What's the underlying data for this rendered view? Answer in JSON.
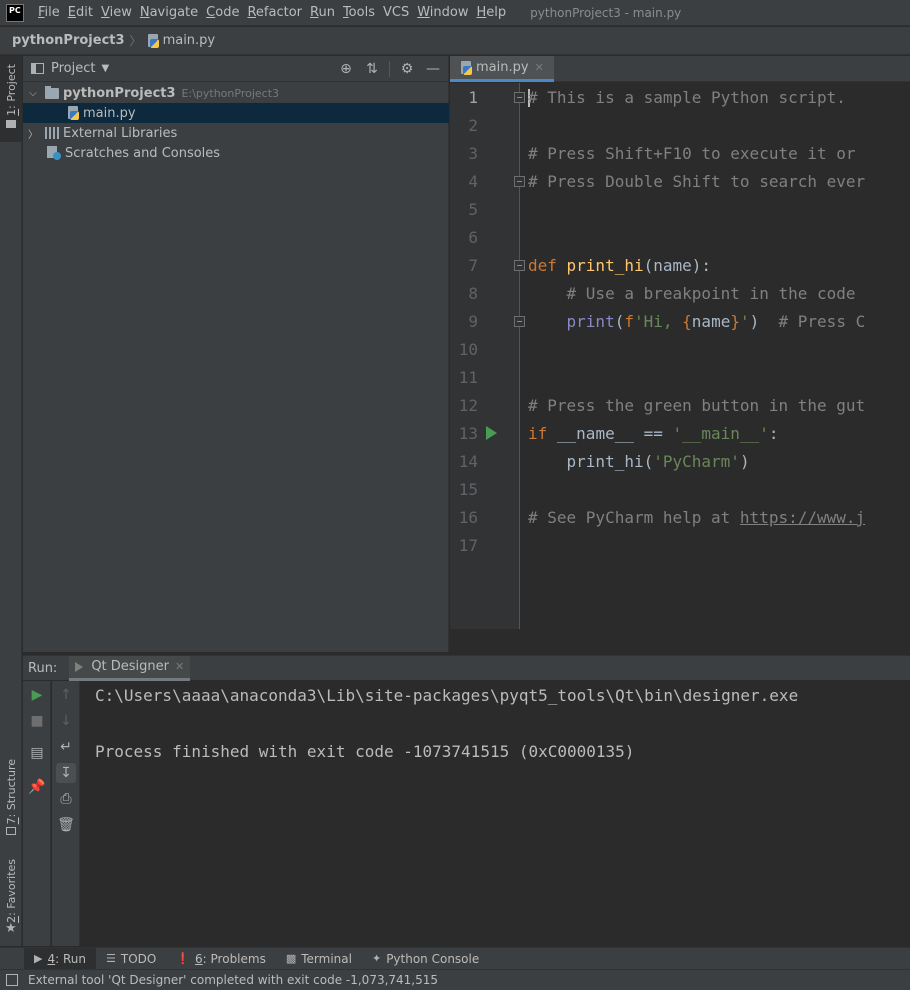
{
  "app": {
    "logo": "PC",
    "window_title": "pythonProject3 - main.py"
  },
  "menu": [
    {
      "underline": "F",
      "rest": "ile"
    },
    {
      "underline": "E",
      "rest": "dit"
    },
    {
      "underline": "V",
      "rest": "iew"
    },
    {
      "underline": "N",
      "rest": "avigate"
    },
    {
      "underline": "C",
      "rest": "ode"
    },
    {
      "underline": "R",
      "rest": "efactor"
    },
    {
      "underline": "R",
      "rest": "un"
    },
    {
      "underline": "T",
      "rest": "ools"
    },
    {
      "underline": "",
      "rest": "VCS"
    },
    {
      "underline": "W",
      "rest": "indow"
    },
    {
      "underline": "H",
      "rest": "elp"
    }
  ],
  "breadcrumb": {
    "project": "pythonProject3",
    "file": "main.py"
  },
  "left_strip": {
    "project_tab_num": "1",
    "project_tab_label": ": Project",
    "structure_tab_num": "7",
    "structure_tab_label": ": Structure",
    "favorites_tab_num": "2",
    "favorites_tab_label": ": Favorites"
  },
  "project_panel": {
    "title": "Project",
    "tree": {
      "root_name": "pythonProject3",
      "root_path": "E:\\pythonProject3",
      "file": "main.py",
      "external_libraries": "External Libraries",
      "scratches": "Scratches and Consoles"
    }
  },
  "editor": {
    "tab_label": "main.py",
    "line_numbers": [
      "1",
      "2",
      "3",
      "4",
      "5",
      "6",
      "7",
      "8",
      "9",
      "10",
      "11",
      "12",
      "13",
      "14",
      "15",
      "16",
      "17"
    ],
    "code": {
      "l1": "# This is a sample Python script.",
      "l3": "# Press Shift+F10 to execute it or",
      "l4": "# Press Double Shift to search ever",
      "l7_kw": "def ",
      "l7_fn": "print_hi",
      "l7_rest": "(name):",
      "l8": "    # Use a breakpoint in the code",
      "l9_indent": "    ",
      "l9_bi": "print",
      "l9_paren": "(",
      "l9_fp": "f",
      "l9_str1": "'Hi, ",
      "l9_brace1": "{",
      "l9_var": "name",
      "l9_brace2": "}",
      "l9_str2": "'",
      "l9_close": ")",
      "l9_com": "  # Press C",
      "l12": "# Press the green button in the gut",
      "l13_kw": "if ",
      "l13_mid": "__name__ == ",
      "l13_str": "'__main__'",
      "l13_end": ":",
      "l14_pre": "    print_hi(",
      "l14_str": "'PyCharm'",
      "l14_end": ")",
      "l16_pre": "# See PyCharm help at ",
      "l16_link": "https://www.j"
    }
  },
  "run_panel": {
    "label": "Run:",
    "tab_label": "Qt Designer",
    "console_lines": [
      "C:\\Users\\aaaa\\anaconda3\\Lib\\site-packages\\pyqt5_tools\\Qt\\bin\\designer.exe",
      "Process finished with exit code -1073741515 (0xC0000135)"
    ]
  },
  "bottom_bar": {
    "run": {
      "num": "4",
      "label": ": Run"
    },
    "todo": "TODO",
    "problems": {
      "num": "6",
      "label": ": Problems"
    },
    "terminal": "Terminal",
    "python_console": "Python Console"
  },
  "status_bar": {
    "message": "External tool 'Qt Designer' completed with exit code -1,073,741,515"
  },
  "colors": {
    "background": "#2b2b2b",
    "panel": "#3c3f41",
    "selection": "#0d293e",
    "accent_tab": "#4a88c7",
    "run_green": "#499c54"
  }
}
